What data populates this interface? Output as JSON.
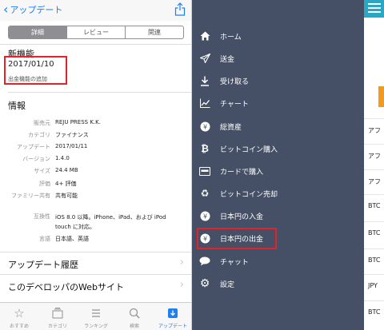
{
  "left": {
    "back_label": "アップデート",
    "segments": [
      "詳細",
      "レビュー",
      "関連"
    ],
    "new_features": {
      "title": "新機能",
      "date": "2017/01/10",
      "description": "出金機能の追加"
    },
    "info": {
      "title": "情報",
      "rows": [
        {
          "key": "販売元",
          "value": "REJU PRESS K.K."
        },
        {
          "key": "カテゴリ",
          "value": "ファイナンス"
        },
        {
          "key": "アップデート",
          "value": "2017/01/11"
        },
        {
          "key": "バージョン",
          "value": "1.4.0"
        },
        {
          "key": "サイズ",
          "value": "24.4 MB"
        },
        {
          "key": "評価",
          "value": "4+ 評価"
        },
        {
          "key": "ファミリー共有",
          "value": "共有可能"
        },
        {
          "key": "互換性",
          "value": "iOS 8.0 以降。iPhone、iPad、および iPod touch に対応。"
        },
        {
          "key": "言語",
          "value": "日本語、英語"
        }
      ]
    },
    "links": [
      "アップデート履歴",
      "このデベロッパのWebサイト"
    ],
    "tabs": [
      "おすすめ",
      "カテゴリ",
      "ランキング",
      "検索",
      "アップデート"
    ]
  },
  "menu": {
    "items": [
      {
        "label": "ホーム",
        "icon": "home-icon"
      },
      {
        "label": "送金",
        "icon": "send-icon"
      },
      {
        "label": "受け取る",
        "icon": "download-icon"
      },
      {
        "label": "チャート",
        "icon": "chart-icon"
      },
      {
        "label": "総資産",
        "icon": "yen-coin-icon"
      },
      {
        "label": "ビットコイン購入",
        "icon": "bitcoin-icon"
      },
      {
        "label": "カードで購入",
        "icon": "card-icon"
      },
      {
        "label": "ビットコイン売却",
        "icon": "recycle-icon"
      },
      {
        "label": "日本円の入金",
        "icon": "yen-coin-icon"
      },
      {
        "label": "日本円の出金",
        "icon": "yen-coin-icon"
      },
      {
        "label": "チャット",
        "icon": "chat-icon"
      },
      {
        "label": "設定",
        "icon": "gear-icon"
      }
    ]
  },
  "right": {
    "rows": [
      "アフ",
      "アフ",
      "アフ",
      "BTC",
      "BTC",
      "BTC",
      "JPY",
      "BTC"
    ]
  },
  "colors": {
    "ios_blue": "#1f7ef0",
    "menu_bg": "#455066",
    "highlight_red": "#e6212a",
    "header_teal": "#27a9c6",
    "accent_orange": "#f29a1f"
  }
}
